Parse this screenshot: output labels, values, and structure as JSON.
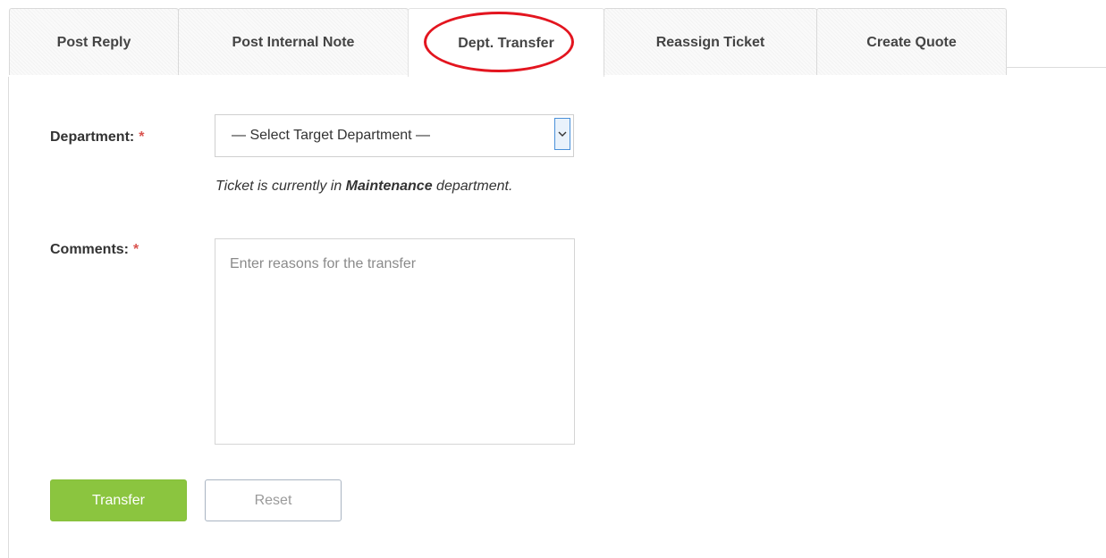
{
  "tabs": [
    {
      "label": "Post Reply"
    },
    {
      "label": "Post Internal Note"
    },
    {
      "label": "Dept. Transfer"
    },
    {
      "label": "Reassign Ticket"
    },
    {
      "label": "Create Quote"
    }
  ],
  "form": {
    "department_label": "Department:",
    "required_mark": "*",
    "department_select_value": "— Select Target Department —",
    "hint_prefix": "Ticket is currently in ",
    "hint_department": "Maintenance",
    "hint_suffix": " department.",
    "comments_label": "Comments:",
    "comments_placeholder": "Enter reasons for the transfer"
  },
  "buttons": {
    "transfer": "Transfer",
    "reset": "Reset"
  },
  "colors": {
    "accent_green": "#8bc53f",
    "highlight_red": "#e3151f",
    "required_red": "#d9534f"
  }
}
